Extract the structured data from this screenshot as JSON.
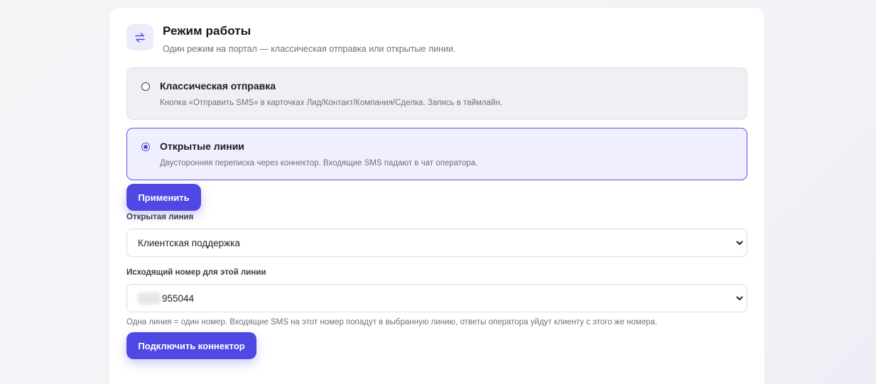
{
  "section": {
    "title": "Режим работы",
    "subtitle": "Один режим на портал — классическая отправка или открытые линии.",
    "icon": "swap-arrows-icon"
  },
  "modes": [
    {
      "title": "Классическая отправка",
      "description": "Кнопка «Отправить SMS» в карточках Лид/Контакт/Компания/Сделка. Запись в таймлайн.",
      "selected": false
    },
    {
      "title": "Открытые линии",
      "description": "Двусторонняя переписка через коннектор. Входящие SMS падают в чат оператора.",
      "selected": true
    }
  ],
  "apply_button": "Применить",
  "open_line": {
    "label": "Открытая линия",
    "value": "Клиентская поддержка"
  },
  "outgoing_number": {
    "label": "Исходящий номер для этой линии",
    "value_visible_part": "955044"
  },
  "hint": "Одна линия = один номер. Входящие SMS на этот номер попадут в выбранную линию, ответы оператора уйдут клиенту с этого же номера.",
  "connect_button": "Подключить коннектор",
  "colors": {
    "accent": "#5048e5",
    "selected_option_bg": "#efefff",
    "option_bg": "#f0f0f4",
    "icon_bg": "#ececfb"
  }
}
